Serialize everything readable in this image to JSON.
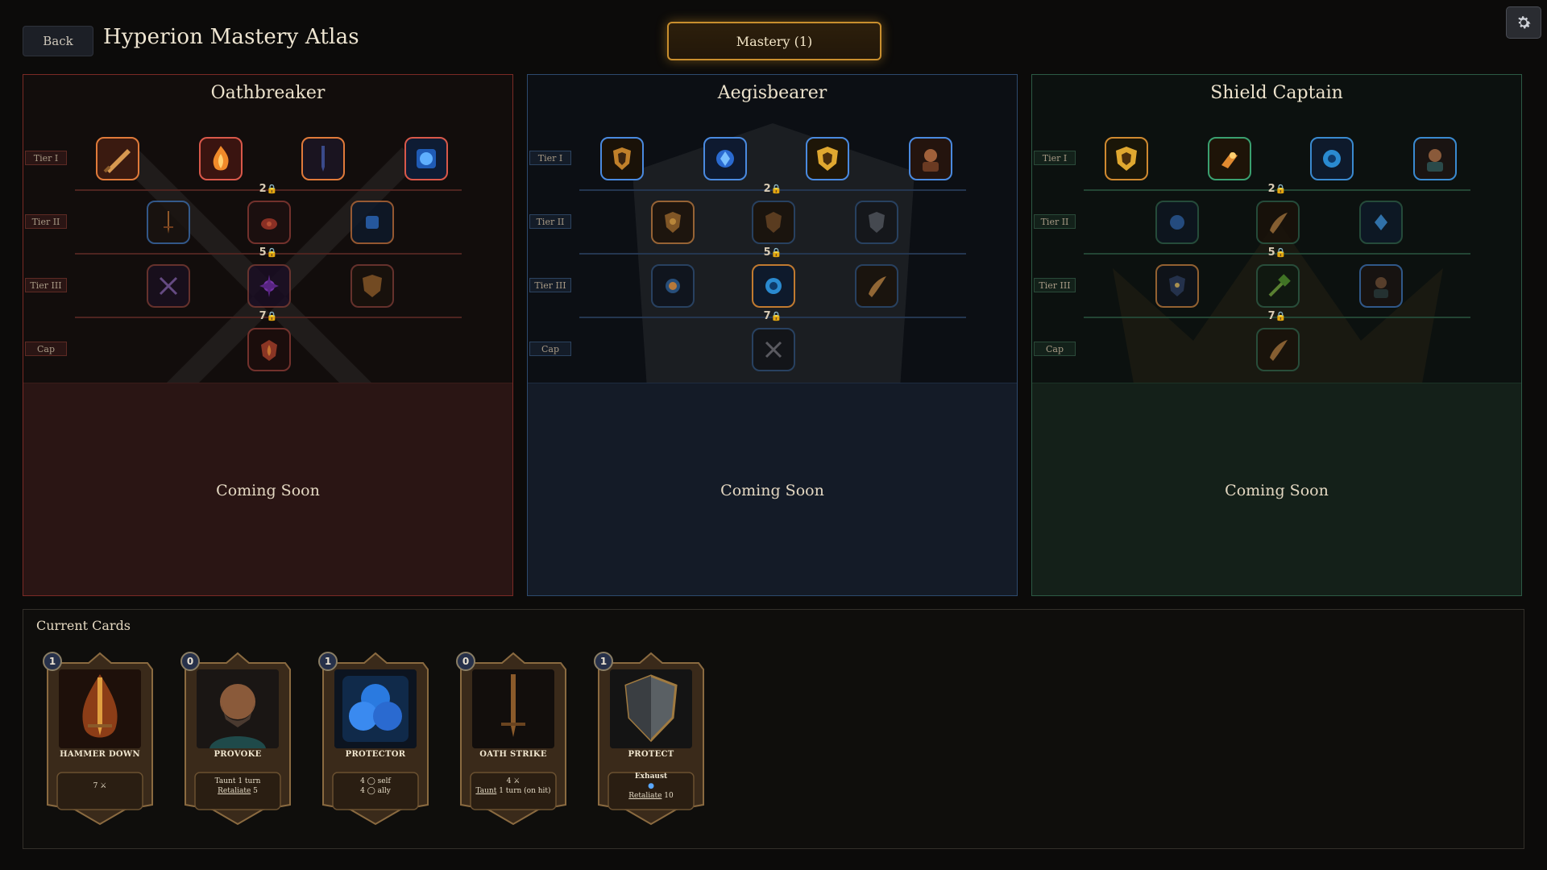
{
  "header": {
    "back_label": "Back",
    "title": "Hyperion Mastery Atlas",
    "mastery_label": "Mastery (1)",
    "settings_icon": "gear-icon"
  },
  "colors": {
    "oathbreaker": "#c0392b",
    "aegisbearer": "#3a7bd5",
    "shield_captain": "#2e9c6a",
    "accent_gold": "#d4a53a"
  },
  "tier_labels": [
    "Tier I",
    "Tier II",
    "Tier III",
    "Cap"
  ],
  "requirements": [
    "2",
    "5",
    "7"
  ],
  "panels": [
    {
      "name": "Oathbreaker",
      "coming_soon": "Coming Soon",
      "tiers": [
        [
          "sword-slash-icon",
          "flame-crest-icon",
          "dark-blade-icon",
          "blue-orb-icon"
        ],
        [
          "ember-sword-icon",
          "fire-sigil-icon",
          "blue-gem-icon"
        ],
        [
          "crossed-blades-icon",
          "void-star-icon",
          "bronze-shield-icon"
        ],
        [
          "flame-shield-icon"
        ]
      ]
    },
    {
      "name": "Aegisbearer",
      "coming_soon": "Coming Soon",
      "tiers": [
        [
          "amber-shield-icon",
          "blue-crystal-icon",
          "golden-crest-icon",
          "warrior-portrait-icon"
        ],
        [
          "sun-shield-icon",
          "bronze-emblem-icon",
          "iron-shield-icon"
        ],
        [
          "sun-orb-icon",
          "blue-swirl-icon",
          "horn-icon"
        ],
        [
          "crossed-swords-icon"
        ]
      ]
    },
    {
      "name": "Shield Captain",
      "coming_soon": "Coming Soon",
      "tiers": [
        [
          "golden-crest-icon",
          "fire-rune-icon",
          "blue-swirl-icon",
          "warrior-portrait-icon"
        ],
        [
          "blue-gem-icon",
          "horn-icon",
          "blue-crystal-icon"
        ],
        [
          "star-shield-icon",
          "green-hammer-icon",
          "warrior-portrait-icon"
        ],
        [
          "horn-icon"
        ]
      ]
    }
  ],
  "cards_section": {
    "title": "Current Cards",
    "cards": [
      {
        "cost": "1",
        "name": "HAMMER DOWN",
        "line1": "7 ⚔",
        "line2": "",
        "line3": "",
        "art": "flaming-sword-icon"
      },
      {
        "cost": "0",
        "name": "PROVOKE",
        "line1": "Taunt 1 turn",
        "line2": "Retaliate",
        "line3": " 5",
        "art": "bearded-warrior-icon"
      },
      {
        "cost": "1",
        "name": "PROTECTOR",
        "line1": "4 ◯ self",
        "line2": "4 ◯ ally",
        "line3": "",
        "art": "blue-bubbles-icon"
      },
      {
        "cost": "0",
        "name": "OATH STRIKE",
        "line1": "4 ⚔",
        "line2": "Taunt",
        "line3": " 1 turn (on hit)",
        "art": "dark-sword-icon"
      },
      {
        "cost": "1",
        "name": "PROTECT",
        "line1": "Exhaust",
        "line2": "Retaliate",
        "line3": " 10",
        "art": "steel-shield-icon"
      }
    ]
  }
}
